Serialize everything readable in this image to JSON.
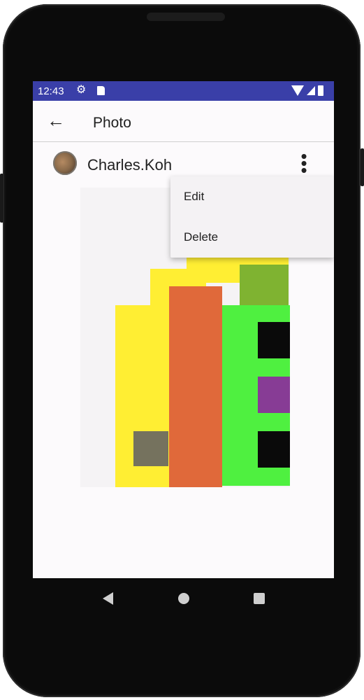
{
  "status_bar": {
    "time": "12:43",
    "icons": [
      "gear-icon",
      "sd-card-icon",
      "wifi-icon",
      "signal-icon",
      "battery-icon"
    ],
    "background_color": "#3a3fa8"
  },
  "app_bar": {
    "title": "Photo",
    "back_icon": "arrow-left-icon"
  },
  "post": {
    "author": "Charles.Koh",
    "more_icon": "more-vert-icon"
  },
  "menu": {
    "items": [
      {
        "label": "Edit"
      },
      {
        "label": "Delete"
      }
    ]
  },
  "nav_bar": {
    "icons": [
      "back-triangle-icon",
      "home-circle-icon",
      "recents-square-icon"
    ]
  },
  "colors": {
    "yellow": "#ffee33",
    "orange": "#e0693a",
    "green": "#4ff040",
    "olive": "#7fb331",
    "purple": "#873c95",
    "gray": "#75725e",
    "black": "#0a0a0a"
  }
}
